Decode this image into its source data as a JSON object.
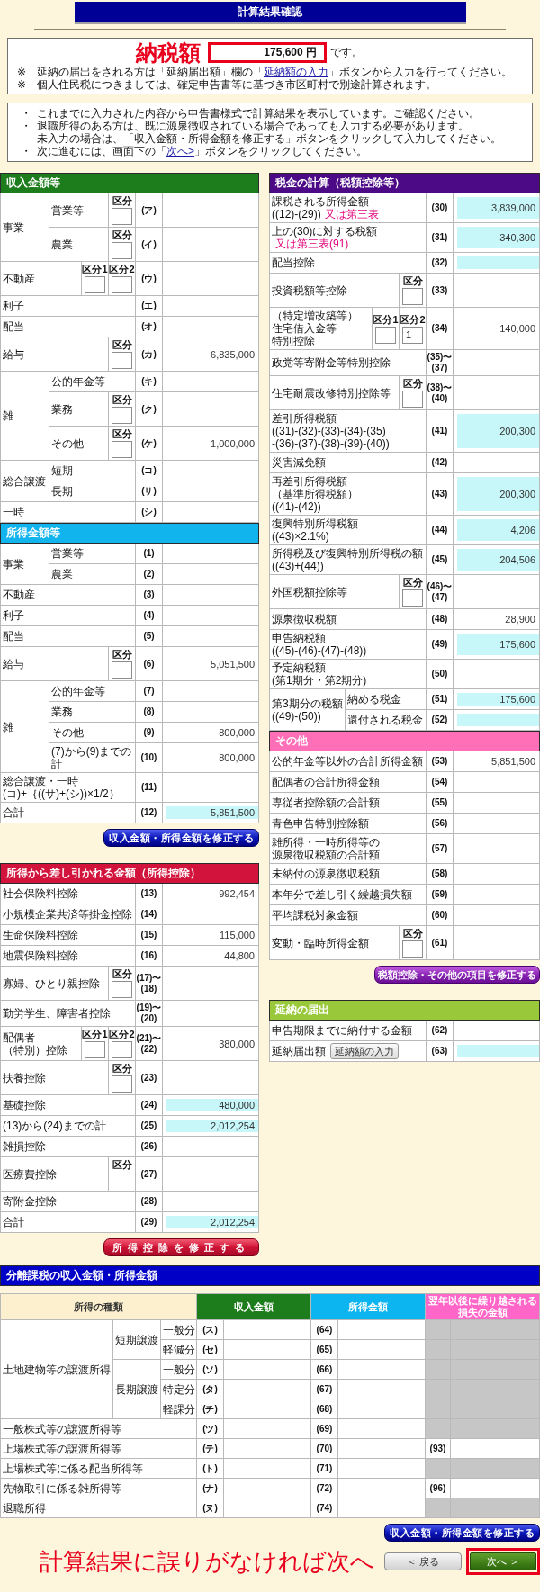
{
  "header": {
    "title": "計算結果確認"
  },
  "tax_summary": {
    "label": "納税額",
    "amount": "175,600 円",
    "suffix": "です。",
    "notes": [
      {
        "mark": "※",
        "before": "延納の届出をされる方は「延納届出額」欄の「",
        "link": "延納額の入力",
        "after": "」ボタンから入力を行ってください。"
      },
      {
        "mark": "※",
        "text": "個人住民税につきましては、確定申告書等に基づき市区町村で別途計算されます。"
      }
    ]
  },
  "guidance": [
    {
      "mark": "・",
      "text": "これまでに入力された内容から申告書様式で計算結果を表示しています。ご確認ください。"
    },
    {
      "mark": "・",
      "lines": [
        "退職所得のある方は、既に源泉徴収されている場合であっても入力する必要があります。",
        "未入力の場合は、「収入金額・所得金額を修正する」ボタンをクリックして入力してください。"
      ]
    },
    {
      "mark": "・",
      "before": "次に進むには、画面下の「",
      "link": "次へ>",
      "after": "」ボタンをクリックしてください。"
    }
  ],
  "income": {
    "title": "収入金額等",
    "rows": [
      {
        "label": "事業",
        "items": [
          {
            "label": "営業等",
            "divisions": [
              {
                "label": "区分",
                "kind": "field"
              }
            ],
            "code": "(ア)",
            "highlighted": false
          },
          {
            "label": "農業",
            "divisions": [
              {
                "label": "区分",
                "kind": "field"
              }
            ],
            "code": "(イ)",
            "highlighted": false
          }
        ]
      },
      {
        "label": "不動産",
        "divisions": [
          {
            "label": "区分1",
            "kind": "field"
          },
          {
            "label": "区分2",
            "kind": "field"
          }
        ],
        "code": "(ウ)",
        "highlighted": false
      },
      {
        "label": "利子",
        "code": "(エ)",
        "highlighted": false
      },
      {
        "label": "配当",
        "code": "(オ)",
        "highlighted": false
      },
      {
        "label": "給与",
        "divisions": [
          {
            "label": "区分",
            "kind": "field"
          }
        ],
        "code": "(カ)",
        "value": "6,835,000",
        "highlighted": false
      },
      {
        "label": "雑",
        "items": [
          {
            "label": "公的年金等",
            "code": "(キ)",
            "highlighted": false
          },
          {
            "label": "業務",
            "divisions": [
              {
                "label": "区分",
                "kind": "field"
              }
            ],
            "code": "(ク)",
            "highlighted": false
          },
          {
            "label": "その他",
            "divisions": [
              {
                "label": "区分",
                "kind": "field"
              }
            ],
            "code": "(ケ)",
            "value": "1,000,000",
            "highlighted": false
          }
        ]
      },
      {
        "label": "総合譲渡",
        "items": [
          {
            "label": "短期",
            "code": "(コ)",
            "highlighted": false
          },
          {
            "label": "長期",
            "code": "(サ)",
            "highlighted": false
          }
        ]
      },
      {
        "label": "一時",
        "code": "(シ)",
        "highlighted": false
      }
    ]
  },
  "earnings": {
    "title": "所得金額等",
    "rows": [
      {
        "label": "事業",
        "items": [
          {
            "label": "営業等",
            "code": "(1)",
            "highlighted": false
          },
          {
            "label": "農業",
            "code": "(2)",
            "highlighted": false
          }
        ]
      },
      {
        "label": "不動産",
        "code": "(3)",
        "highlighted": false
      },
      {
        "label": "利子",
        "code": "(4)",
        "highlighted": false
      },
      {
        "label": "配当",
        "code": "(5)",
        "highlighted": false
      },
      {
        "label": "給与",
        "divisions": [
          {
            "label": "区分",
            "kind": "field"
          }
        ],
        "code": "(6)",
        "value": "5,051,500",
        "highlighted": false
      },
      {
        "label": "雑",
        "items": [
          {
            "label": "公的年金等",
            "code": "(7)",
            "highlighted": false
          },
          {
            "label": "業務",
            "code": "(8)",
            "highlighted": false
          },
          {
            "label": "その他",
            "code": "(9)",
            "value": "800,000",
            "highlighted": false
          },
          {
            "label": "(7)から(9)までの計",
            "code": "(10)",
            "value": "800,000",
            "highlighted": false
          }
        ]
      },
      {
        "label": "総合譲渡・一時\n(コ)+｛((サ)+(シ))×1/2｝",
        "code": "(11)",
        "highlighted": false
      },
      {
        "label": "合計",
        "code": "(12)",
        "value": "5,851,500",
        "highlighted": true
      }
    ],
    "button": "収入金額・所得金額を修正する"
  },
  "deductions": {
    "title": "所得から差し引かれる金額（所得控除）",
    "rows": [
      {
        "label": "社会保険料控除",
        "code": "(13)",
        "value": "992,454",
        "highlighted": false
      },
      {
        "label": "小規模企業共済等掛金控除",
        "code": "(14)",
        "highlighted": false
      },
      {
        "label": "生命保険料控除",
        "code": "(15)",
        "value": "115,000",
        "highlighted": false
      },
      {
        "label": "地震保険料控除",
        "code": "(16)",
        "value": "44,800",
        "highlighted": false
      },
      {
        "label": "寡婦、ひとり親控除",
        "divisions": [
          {
            "label": "区分",
            "kind": "field"
          }
        ],
        "code": "(17)〜(18)",
        "highlighted": false
      },
      {
        "label": "勤労学生、障害者控除",
        "code": "(19)〜(20)",
        "highlighted": false
      },
      {
        "lines": [
          "配偶者",
          "（特別）控除"
        ],
        "divisions": [
          {
            "label": "区分1",
            "kind": "field"
          },
          {
            "label": "区分2",
            "kind": "field"
          }
        ],
        "code": "(21)〜(22)",
        "value": "380,000",
        "highlighted": false
      },
      {
        "label": "扶養控除",
        "divisions": [
          {
            "label": "区分",
            "kind": "field"
          }
        ],
        "code": "(23)",
        "highlighted": false
      },
      {
        "label": "基礎控除",
        "code": "(24)",
        "value": "480,000",
        "highlighted": true
      },
      {
        "label": "(13)から(24)までの計",
        "code": "(25)",
        "value": "2,012,254",
        "highlighted": true
      },
      {
        "label": "雑損控除",
        "code": "(26)",
        "highlighted": false
      },
      {
        "label": "医療費控除",
        "divisions": [
          {
            "label": "区分",
            "kind": "label"
          }
        ],
        "code": "(27)",
        "highlighted": false
      },
      {
        "label": "寄附金控除",
        "code": "(28)",
        "highlighted": false
      },
      {
        "label": "合計",
        "code": "(29)",
        "value": "2,012,254",
        "highlighted": true
      }
    ],
    "button": "所得控除を修正する"
  },
  "tax_calculation": {
    "title": "税金の計算（税額控除等）",
    "rows": [
      {
        "label": "課税される所得金額\n((12)-(29))",
        "note": "又は第三表",
        "code": "(30)",
        "value": "3,839,000",
        "highlighted": true
      },
      {
        "label": "上の(30)に対する税額",
        "note": "又は第三表(91)",
        "code": "(31)",
        "value": "340,300",
        "highlighted": true
      },
      {
        "label": "配当控除",
        "code": "(32)",
        "highlighted": true
      },
      {
        "label": "投資税額等控除",
        "divisions": [
          {
            "label": "区分",
            "kind": "field"
          }
        ],
        "code": "(33)",
        "highlighted": false
      },
      {
        "lines": [
          "（特定増改築等）",
          "住宅借入金等",
          "特別控除"
        ],
        "divisions": [
          {
            "label": "区分1",
            "kind": "field"
          },
          {
            "label": "区分2",
            "kind": "field",
            "value": "1"
          }
        ],
        "code": "(34)",
        "value": "140,000",
        "highlighted": false
      },
      {
        "label": "政党等寄附金等特別控除",
        "code": "(35)〜(37)",
        "highlighted": false
      },
      {
        "label": "住宅耐震改修特別控除等",
        "divisions": [
          {
            "label": "区分",
            "kind": "field"
          }
        ],
        "code": "(38)〜(40)",
        "highlighted": false
      },
      {
        "label": "差引所得税額\n((31)-(32)-(33)-(34)-(35)\n-(36)-(37)-(38)-(39)-(40))",
        "code": "(41)",
        "value": "200,300",
        "highlighted": true
      },
      {
        "label": "災害減免額",
        "code": "(42)",
        "highlighted": false
      },
      {
        "lines": [
          "再差引所得税額",
          "（基準所得税額）",
          "((41)-(42))"
        ],
        "code": "(43)",
        "value": "200,300",
        "highlighted": true
      },
      {
        "label": "復興特別所得税額\n((43)×2.1%)",
        "code": "(44)",
        "value": "4,206",
        "highlighted": true
      },
      {
        "label": "所得税及び復興特別所得税の額\n((43)+(44))",
        "code": "(45)",
        "value": "204,506",
        "highlighted": true
      },
      {
        "label": "外国税額控除等",
        "divisions": [
          {
            "label": "区分",
            "kind": "field"
          }
        ],
        "code": "(46)〜(47)",
        "highlighted": false
      },
      {
        "label": "源泉徴収税額",
        "code": "(48)",
        "value": "28,900",
        "highlighted": false
      },
      {
        "label": "申告納税額\n((45)-(46)-(47)-(48))",
        "code": "(49)",
        "value": "175,600",
        "highlighted": true
      },
      {
        "label": "予定納税額\n(第1期分・第2期分)",
        "code": "(50)",
        "highlighted": false
      },
      {
        "label": "第3期分の税額\n((49)-(50))",
        "items": [
          {
            "label": "納める税金",
            "code": "(51)",
            "value": "175,600",
            "highlighted": true
          },
          {
            "label": "還付される税金",
            "code": "(52)",
            "highlighted": true
          }
        ]
      }
    ]
  },
  "other": {
    "title": "その他",
    "rows": [
      {
        "label": "公的年金等以外の合計所得金額",
        "code": "(53)",
        "value": "5,851,500",
        "highlighted": false
      },
      {
        "label": "配偶者の合計所得金額",
        "code": "(54)",
        "highlighted": false
      },
      {
        "label": "専従者控除額の合計額",
        "code": "(55)",
        "highlighted": false
      },
      {
        "label": "青色申告特別控除額",
        "code": "(56)",
        "highlighted": false
      },
      {
        "lines": [
          "雑所得・一時所得等の",
          "源泉徴収税額の合計額"
        ],
        "code": "(57)",
        "highlighted": false
      },
      {
        "label": "未納付の源泉徴収税額",
        "code": "(58)",
        "highlighted": false
      },
      {
        "label": "本年分で差し引く繰越損失額",
        "code": "(59)",
        "highlighted": false
      },
      {
        "label": "平均課税対象金額",
        "code": "(60)",
        "highlighted": false
      },
      {
        "label": "変動・臨時所得金額",
        "divisions": [
          {
            "label": "区分",
            "kind": "field"
          }
        ],
        "code": "(61)",
        "highlighted": false
      }
    ],
    "button": "税額控除・その他の項目を修正する"
  },
  "deferral": {
    "title": "延納の届出",
    "rows": [
      {
        "label": "申告期限までに納付する金額",
        "code": "(62)",
        "highlighted": false
      },
      {
        "label": "延納届出額",
        "action": "延納額の入力",
        "code": "(63)",
        "highlighted": true
      }
    ]
  },
  "separate": {
    "title": "分離課税の収入金額・所得金額",
    "columns": [
      "所得の種類",
      "収入金額",
      "所得金額",
      "翌年以後に繰り越される損失の金額"
    ],
    "rows": [
      {
        "label": "土地建物等の譲渡所得",
        "items": [
          {
            "label": "短期譲渡",
            "items": [
              {
                "label": "一般分",
                "income_code": "(ス)",
                "earnings_code": "(64)",
                "loss_disabled": true
              },
              {
                "label": "軽減分",
                "income_code": "(セ)",
                "earnings_code": "(65)",
                "loss_disabled": true
              }
            ]
          },
          {
            "label": "長期譲渡",
            "items": [
              {
                "label": "一般分",
                "income_code": "(ソ)",
                "earnings_code": "(66)",
                "loss_disabled": true
              },
              {
                "label": "特定分",
                "income_code": "(タ)",
                "earnings_code": "(67)",
                "loss_disabled": true
              },
              {
                "label": "軽課分",
                "income_code": "(チ)",
                "earnings_code": "(68)",
                "loss_disabled": true
              }
            ]
          }
        ]
      },
      {
        "label": "一般株式等の譲渡所得等",
        "income_code": "(ツ)",
        "earnings_code": "(69)",
        "loss_disabled": true
      },
      {
        "label": "上場株式等の譲渡所得等",
        "income_code": "(テ)",
        "earnings_code": "(70)",
        "loss_code": "(93)",
        "loss_disabled": false
      },
      {
        "label": "上場株式等に係る配当所得等",
        "income_code": "(ト)",
        "earnings_code": "(71)",
        "loss_disabled": true
      },
      {
        "label": "先物取引に係る雑所得等",
        "income_code": "(ナ)",
        "earnings_code": "(72)",
        "loss_code": "(96)",
        "loss_disabled": false
      },
      {
        "label": "退職所得",
        "income_code": "(ヌ)",
        "earnings_code": "(74)",
        "loss_disabled": true
      }
    ],
    "button": "収入金額・所得金額を修正する"
  },
  "footer": {
    "prompt": "計算結果に誤りがなければ次へ",
    "buttons": [
      {
        "label": "＜ 戻る",
        "kind": "back",
        "highlighted": false
      },
      {
        "label": "次へ ＞",
        "kind": "next",
        "highlighted": true
      }
    ]
  }
}
